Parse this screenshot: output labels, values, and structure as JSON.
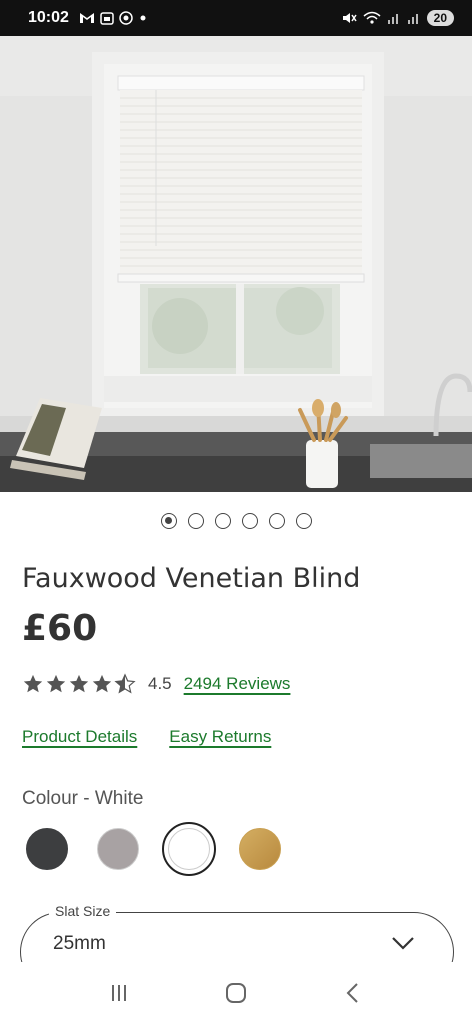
{
  "status_bar": {
    "time": "10:02",
    "left_icons": [
      "gmail-icon",
      "calendar-icon",
      "app-icon",
      "dot-icon"
    ],
    "battery": "20"
  },
  "product": {
    "title": "Fauxwood Venetian Blind",
    "price": "£60",
    "rating": "4.5",
    "reviews_link": "2494 Reviews",
    "stars_filled": 4.5,
    "stars_total": 5
  },
  "carousel": {
    "count": 6,
    "active_index": 0
  },
  "links": {
    "product_details": "Product Details",
    "easy_returns": "Easy Returns"
  },
  "colour": {
    "label": "Colour - White",
    "swatches": [
      {
        "name": "charcoal",
        "color": "#3d3e40"
      },
      {
        "name": "grey",
        "color": "#a8a2a3"
      },
      {
        "name": "white",
        "color": "#ffffff",
        "selected": true
      },
      {
        "name": "oak",
        "color": "#c9a052"
      }
    ]
  },
  "slat_size": {
    "label": "Slat Size",
    "value": "25mm"
  },
  "colors": {
    "link_green": "#1c7a2c",
    "text": "#333333"
  }
}
